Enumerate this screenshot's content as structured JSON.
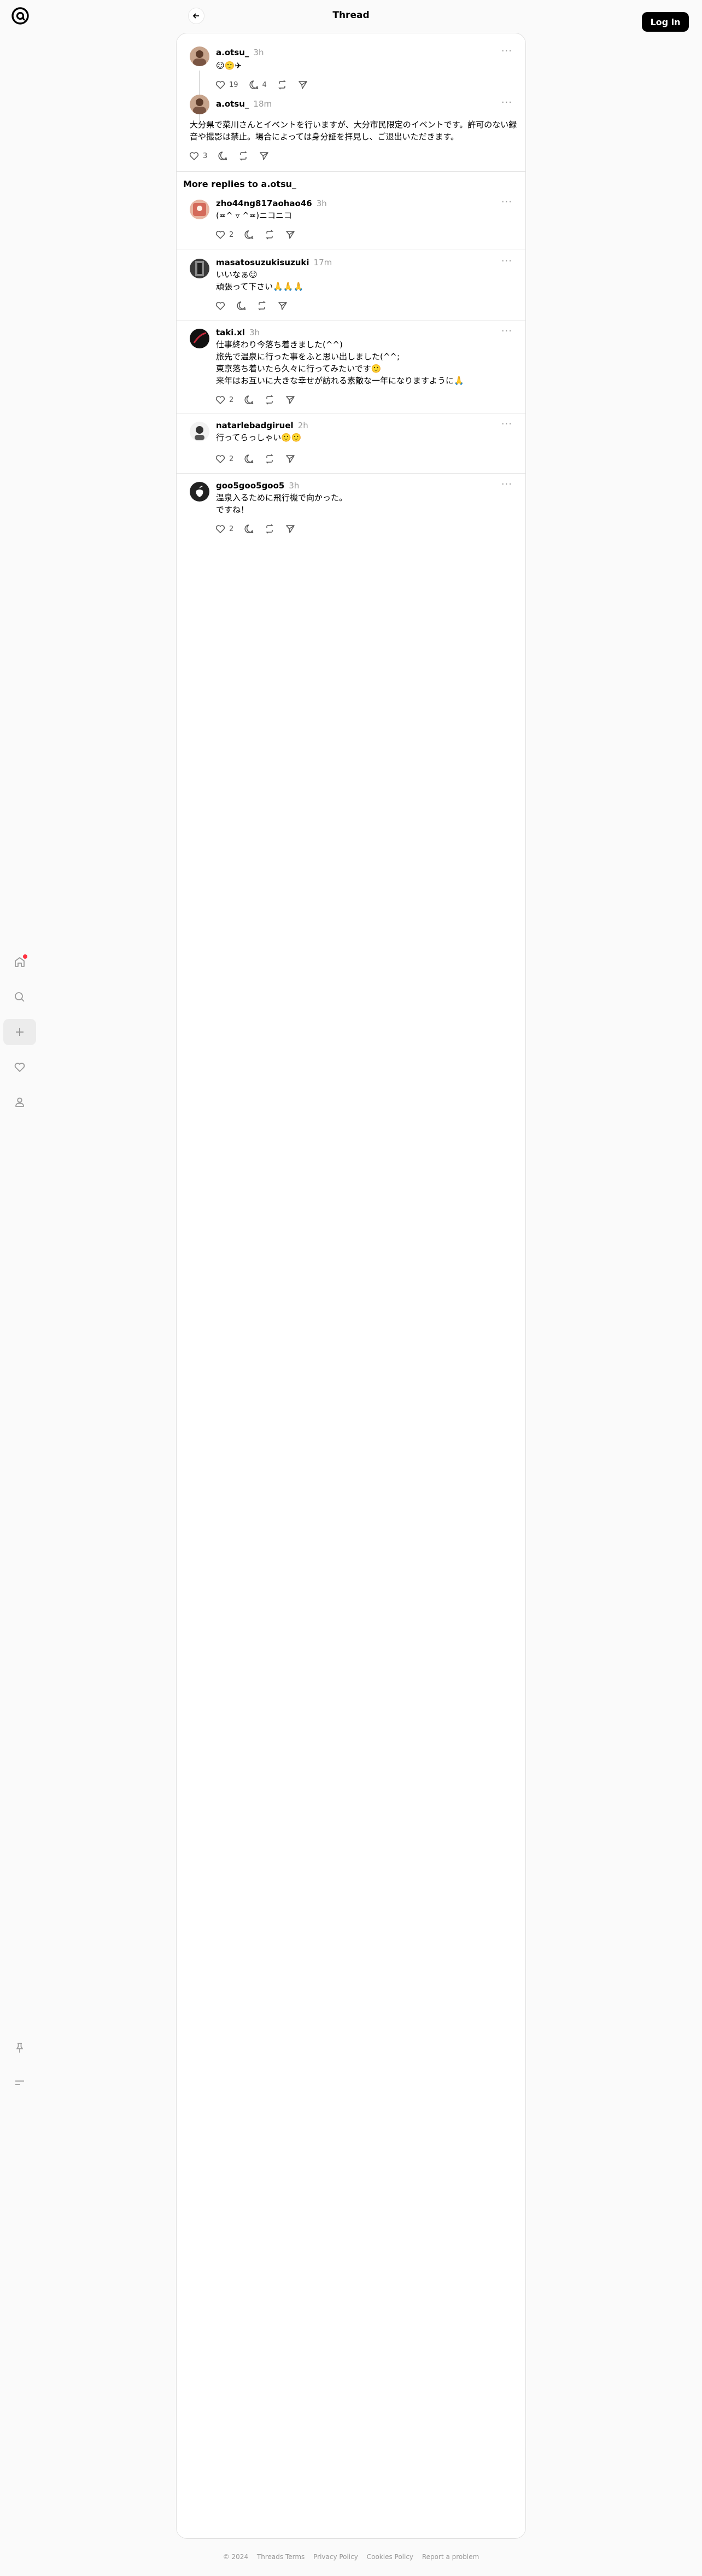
{
  "header": {
    "title": "Thread",
    "login_label": "Log in"
  },
  "thread": {
    "parent": {
      "username": "a.otsu_",
      "time": "3h",
      "text": "☺︎🙂✈︎",
      "likes": "19",
      "replies": "4"
    },
    "reply": {
      "username": "a.otsu_",
      "time": "18m",
      "text": "大分県で菜川さんとイベントを行いますが、大分市民限定のイベントです。許可のない録音や撮影は禁止。場合によっては身分証を拝見し、ご退出いただきます。",
      "likes": "3"
    }
  },
  "more_replies": {
    "title": "More replies to a.otsu_",
    "items": [
      {
        "username": "zho44ng817aohao46",
        "time": "3h",
        "text": [
          "(≖^ ▿ ^≖)ニコニコ"
        ],
        "likes": "2"
      },
      {
        "username": "masatosuzukisuzuki",
        "time": "17m",
        "text": [
          "いいなぁ☺︎",
          "頑張って下さい🙏🙏🙏"
        ],
        "likes": ""
      },
      {
        "username": "taki.xl",
        "time": "3h",
        "text": [
          "仕事終わり今落ち着きました(^^)",
          "旅先で温泉に行った事をふと思い出しました(^^;",
          "東京落ち着いたら久々に行ってみたいです🙂",
          "来年はお互いに大きな幸せが訪れる素敵な一年になりますように🙏"
        ],
        "likes": "2"
      },
      {
        "username": "natarlebadgiruel",
        "time": "2h",
        "text": [
          "行ってらっしゃい🙂🙂"
        ],
        "likes": "2"
      },
      {
        "username": "goo5goo5goo5",
        "time": "3h",
        "text": [
          "温泉入るために飛行機で向かった。",
          "ですね！"
        ],
        "likes": "2"
      }
    ]
  },
  "footer": {
    "copyright": "© 2024",
    "links": [
      "Threads Terms",
      "Privacy Policy",
      "Cookies Policy",
      "Report a problem"
    ]
  },
  "icons": {
    "logo": "threads-logo-icon",
    "nav": [
      "home-icon",
      "search-icon",
      "create-icon",
      "activity-heart-icon",
      "profile-icon",
      "pin-icon",
      "menu-icon"
    ]
  },
  "colors": {
    "notification": "#ff3040",
    "login_bg": "#000000"
  }
}
